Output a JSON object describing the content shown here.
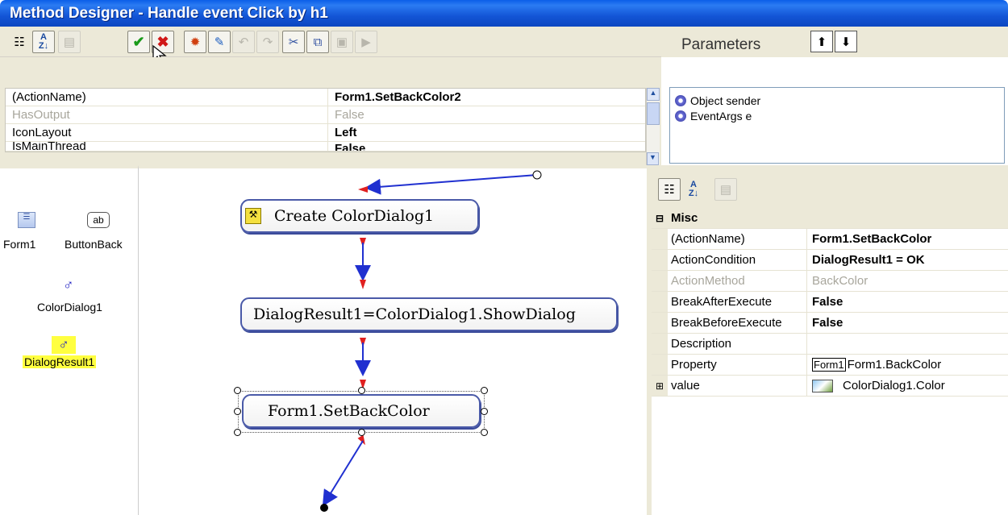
{
  "window": {
    "title": "Method Designer - Handle event Click by h1"
  },
  "toolbar": {
    "icons": [
      "categorized-icon",
      "alphabetical-icon",
      "property-pages-icon",
      "ok-icon",
      "cancel-icon",
      "new-action-icon",
      "draw-icon",
      "undo-icon",
      "redo-icon",
      "cut-icon",
      "copy-icon",
      "paste-icon",
      "run-icon"
    ],
    "sort_label": "A Z"
  },
  "parameters": {
    "title": "Parameters",
    "items": [
      "Object sender",
      "EventArgs e"
    ]
  },
  "action_props": [
    {
      "name": "(ActionName)",
      "value": "Form1.SetBackColor2",
      "disabled": false
    },
    {
      "name": "HasOutput",
      "value": "False",
      "disabled": true
    },
    {
      "name": "IconLayout",
      "value": "Left",
      "disabled": false
    },
    {
      "name": "IsMainThread",
      "value": "False",
      "disabled": false
    }
  ],
  "components": {
    "form1": "Form1",
    "button": "ButtonBack",
    "colordialog": "ColorDialog1",
    "dialogresult": "DialogResult1",
    "button_glyph": "ab"
  },
  "flow": {
    "nodes": [
      "Create ColorDialog1",
      "DialogResult1=ColorDialog1.ShowDialog",
      "Form1.SetBackColor"
    ]
  },
  "properties": {
    "category": "Misc",
    "rows": [
      {
        "name": "(ActionName)",
        "value": "Form1.SetBackColor"
      },
      {
        "name": "ActionCondition",
        "value": "DialogResult1 = OK"
      },
      {
        "name": "ActionMethod",
        "value": "BackColor"
      },
      {
        "name": "BreakAfterExecute",
        "value": "False"
      },
      {
        "name": "BreakBeforeExecute",
        "value": "False"
      },
      {
        "name": "Description",
        "value": ""
      },
      {
        "name": "Property",
        "value": "Form1.BackColor",
        "badge": "Form1"
      },
      {
        "name": "value",
        "value": "ColorDialog1.Color"
      }
    ]
  },
  "colors": {
    "accent": "#1355d6",
    "arrow_red": "#e02020",
    "arrow_blue": "#2030d0",
    "highlight": "#ffff40"
  }
}
